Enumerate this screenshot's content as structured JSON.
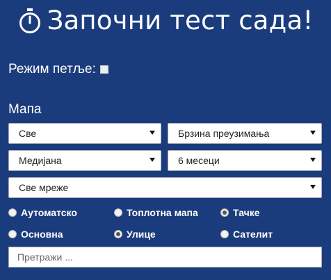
{
  "header": {
    "title": "Започни тест сада!",
    "icon": "stopwatch-icon"
  },
  "loop": {
    "label": "Режим петље:",
    "checked": false
  },
  "map": {
    "label": "Мапа"
  },
  "selects": {
    "filter": "Све",
    "metric": "Брзина преузимања",
    "stat": "Медијана",
    "period": "6 месеци",
    "network": "Све мреже"
  },
  "radios": {
    "automatic": "Аутоматско",
    "heatmap": "Топлотна мапа",
    "points": "Тачке",
    "basic": "Основна",
    "streets": "Улице",
    "satellite": "Сателит",
    "selected_type": "Тачке",
    "selected_base": "Улице"
  },
  "search": {
    "placeholder": "Претражи ..."
  }
}
